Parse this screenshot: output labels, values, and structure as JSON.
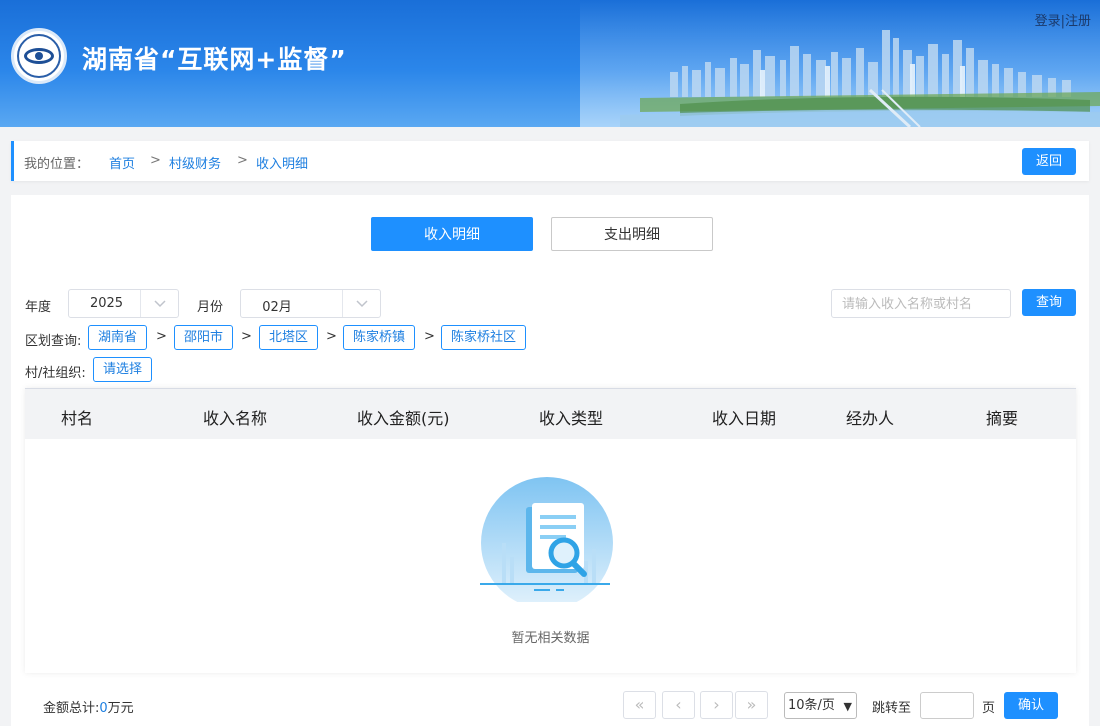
{
  "header": {
    "title": "湖南省“互联网+监督”",
    "login": "登录",
    "divider": "|",
    "register": "注册"
  },
  "breadcrumb": {
    "label": "我的位置：",
    "items": [
      "首页",
      "村级财务",
      "收入明细"
    ],
    "separator": ">",
    "back": "返回"
  },
  "tabs": {
    "income": "收入明细",
    "expense": "支出明细"
  },
  "filters": {
    "year_label": "年度",
    "year_value": "2025",
    "month_label": "月份",
    "month_value": "02月",
    "search_placeholder": "请输入收入名称或村名",
    "query": "查询",
    "region_label": "区划查询:",
    "regions": [
      "湖南省",
      "邵阳市",
      "北塔区",
      "陈家桥镇",
      "陈家桥社区"
    ],
    "region_sep": ">",
    "org_label": "村/社组织:",
    "org_value": "请选择"
  },
  "table": {
    "columns": [
      "村名",
      "收入名称",
      "收入金额(元)",
      "收入类型",
      "收入日期",
      "经办人",
      "摘要"
    ],
    "empty_text": "暂无相关数据"
  },
  "footer": {
    "total_label": "金额总计:",
    "total_value": "0",
    "total_unit": "万元",
    "first": "«",
    "prev": "‹",
    "next": "›",
    "last": "»",
    "page_size": "10条/页",
    "jump_label": "跳转至",
    "page_unit": "页",
    "confirm": "确认"
  },
  "colors": {
    "accent": "#1e90ff",
    "header_top": "#1a6fd8"
  }
}
